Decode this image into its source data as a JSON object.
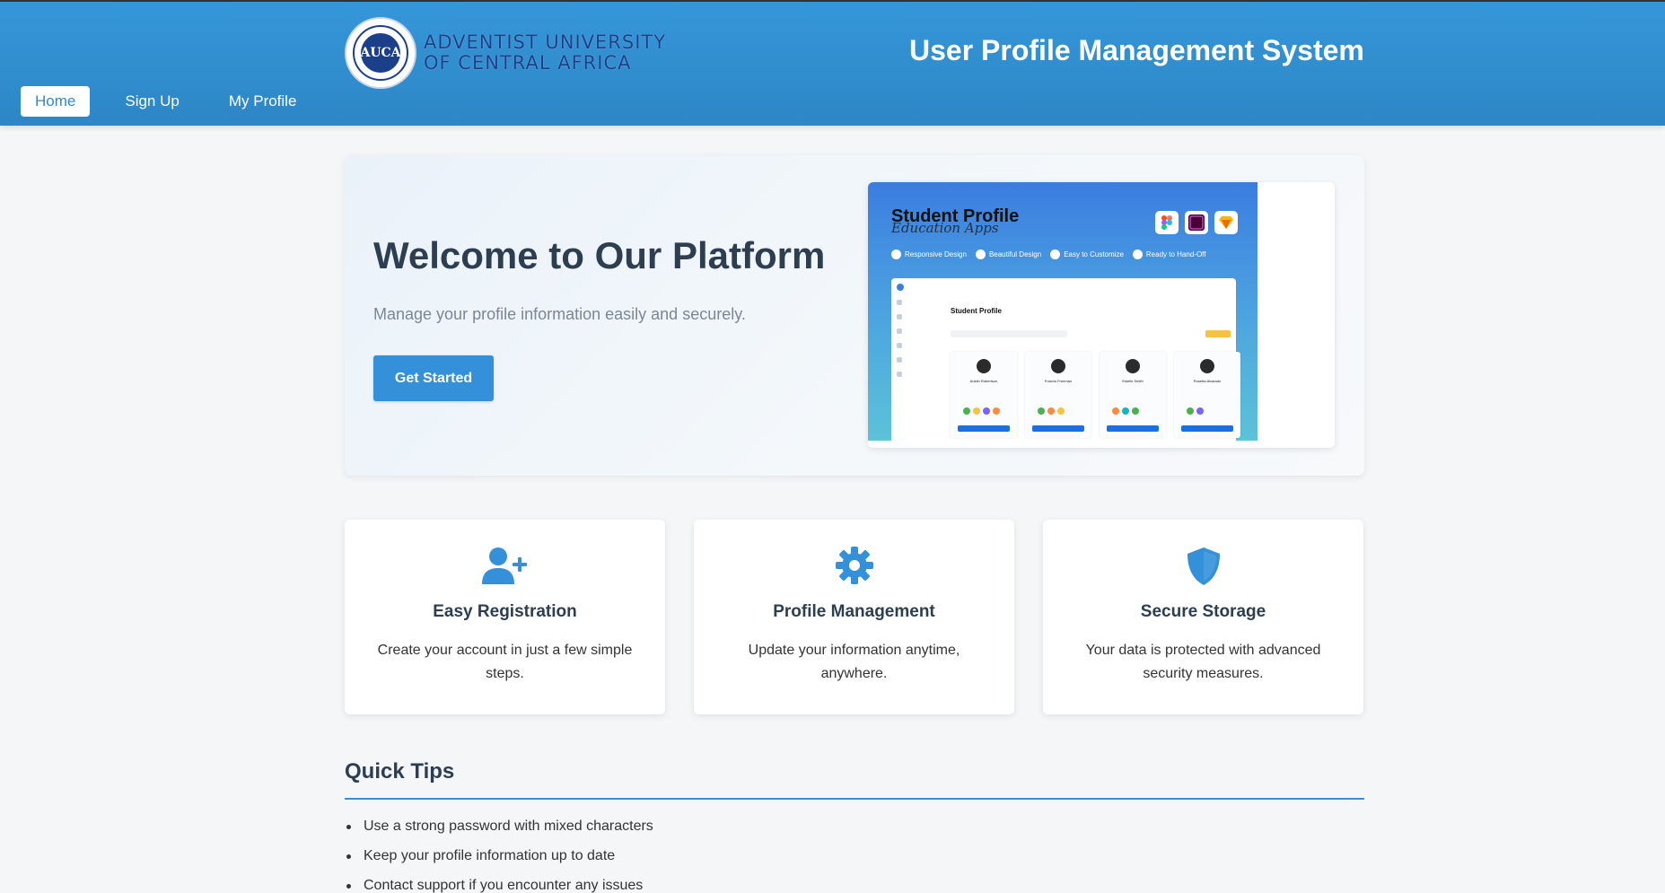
{
  "header": {
    "logo_lines": [
      "ADVENTIST UNIVERSITY",
      "OF CENTRAL AFRICA"
    ],
    "logo_seal_text": "AUCA",
    "title": "User Profile Management System",
    "nav": [
      {
        "label": "Home",
        "active": true
      },
      {
        "label": "Sign Up",
        "active": false
      },
      {
        "label": "My Profile",
        "active": false
      }
    ],
    "brand_color": "#3597d9"
  },
  "hero": {
    "title": "Welcome to Our Platform",
    "subtitle": "Manage your profile information easily and securely.",
    "cta_label": "Get Started",
    "image": {
      "title": "Student Profile",
      "script": "Education Apps",
      "features": [
        "Responsive Design",
        "Beautiful Design",
        "Easy to Customize",
        "Ready to Hand-Off"
      ],
      "app_title": "Student Profile",
      "students": [
        "Austin Robertson",
        "Francis Freeman",
        "Estelle Smith",
        "Rosetta Alvarado"
      ]
    }
  },
  "features": [
    {
      "icon": "user-plus-icon",
      "title": "Easy Registration",
      "desc": "Create your account in just a few simple steps."
    },
    {
      "icon": "gear-icon",
      "title": "Profile Management",
      "desc": "Update your information anytime, anywhere."
    },
    {
      "icon": "shield-icon",
      "title": "Secure Storage",
      "desc": "Your data is protected with advanced security measures."
    }
  ],
  "tips": {
    "title": "Quick Tips",
    "items": [
      "Use a strong password with mixed characters",
      "Keep your profile information up to date",
      "Contact support if you encounter any issues"
    ]
  },
  "accent_color": "#3490d8"
}
